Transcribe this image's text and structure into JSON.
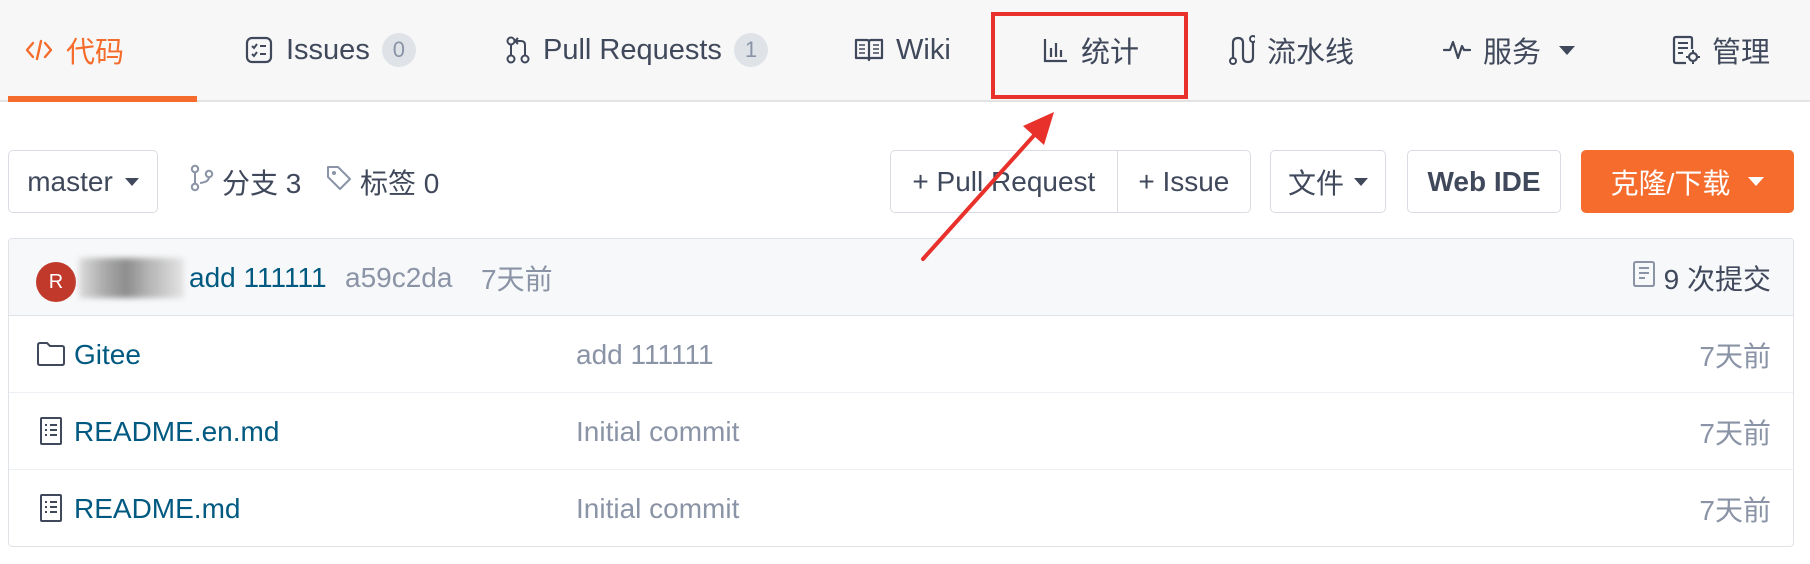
{
  "nav": {
    "tabs": [
      {
        "label": "代码",
        "icon": "code-icon",
        "active": true
      },
      {
        "label": "Issues",
        "icon": "issues-icon",
        "badge": "0"
      },
      {
        "label": "Pull Requests",
        "icon": "pull-request-icon",
        "badge": "1"
      },
      {
        "label": "Wiki",
        "icon": "wiki-book-icon"
      },
      {
        "label": "统计",
        "icon": "bar-chart-icon",
        "highlighted": true
      },
      {
        "label": "流水线",
        "icon": "pipeline-icon"
      },
      {
        "label": "服务",
        "icon": "pulse-icon",
        "dropdown": true
      },
      {
        "label": "管理",
        "icon": "settings-doc-icon"
      }
    ]
  },
  "toolbar": {
    "branch": "master",
    "branches_label": "分支 3",
    "tags_label": "标签 0",
    "pull_request_button": "+ Pull Request",
    "issue_button": "+ Issue",
    "file_button": "文件",
    "web_ide_button": "Web IDE",
    "clone_button": "克隆/下载"
  },
  "last_commit": {
    "avatar_letter": "R",
    "message": "add 111111",
    "hash": "a59c2da",
    "time": "7天前",
    "commit_count": "9 次提交"
  },
  "files": [
    {
      "name": "Gitee",
      "type": "folder",
      "message": "add 111111",
      "time": "7天前"
    },
    {
      "name": "README.en.md",
      "type": "file",
      "message": "Initial commit",
      "time": "7天前"
    },
    {
      "name": "README.md",
      "type": "file",
      "message": "Initial commit",
      "time": "7天前"
    }
  ],
  "colors": {
    "accent": "#f56c2d",
    "link": "#005980",
    "annotation": "#e8312a"
  }
}
